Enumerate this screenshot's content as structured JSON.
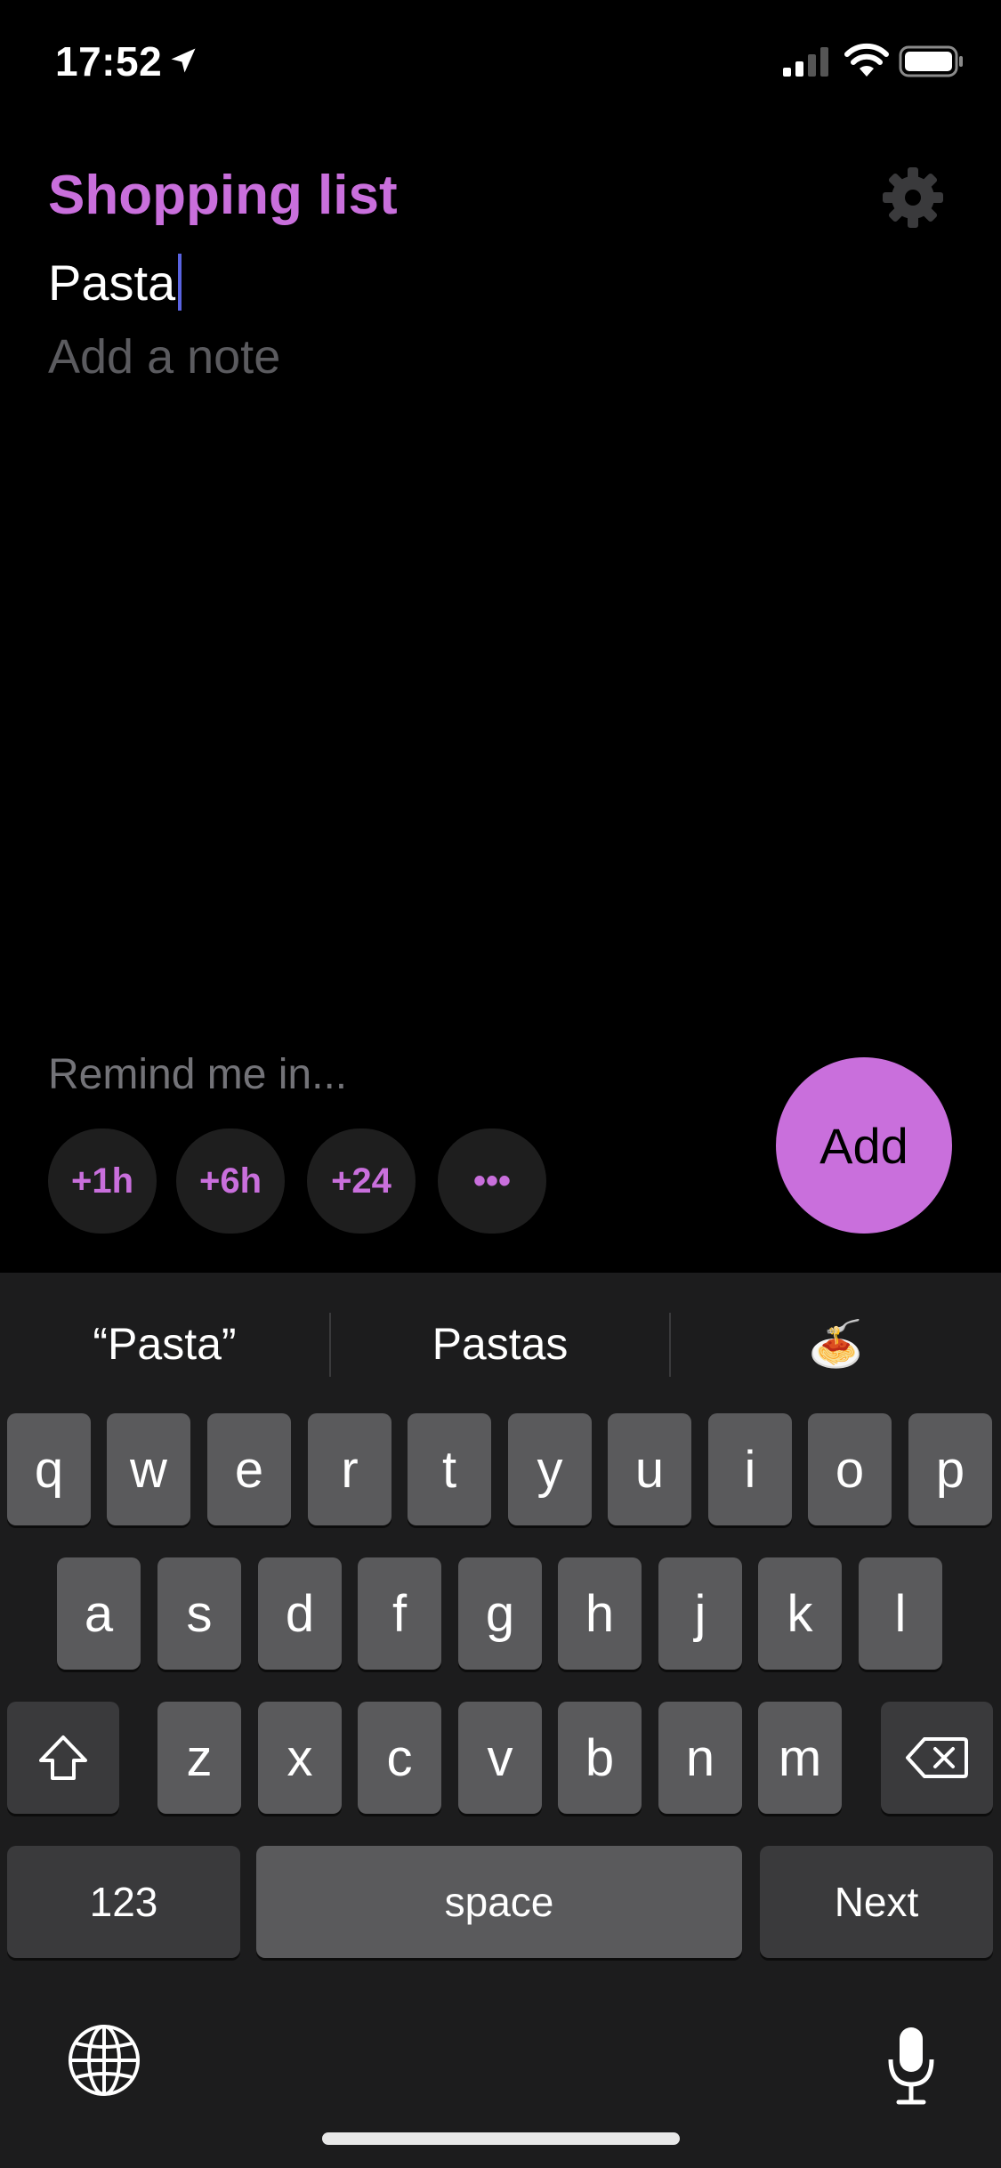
{
  "status_bar": {
    "time": "17:52",
    "icons": [
      "location-arrow-icon",
      "cellular-signal-icon",
      "wifi-icon",
      "battery-icon"
    ]
  },
  "header": {
    "title": "Shopping list",
    "settings_icon": "gear-icon"
  },
  "item_field": {
    "value": "Pasta"
  },
  "note_field": {
    "placeholder": "Add a note"
  },
  "reminder": {
    "label": "Remind me in...",
    "options": [
      "+1h",
      "+6h",
      "+24",
      "•••"
    ]
  },
  "add_button": {
    "label": "Add"
  },
  "keyboard": {
    "suggestions": [
      "“Pasta”",
      "Pastas",
      "🍝"
    ],
    "row1": [
      "q",
      "w",
      "e",
      "r",
      "t",
      "y",
      "u",
      "i",
      "o",
      "p"
    ],
    "row2": [
      "a",
      "s",
      "d",
      "f",
      "g",
      "h",
      "j",
      "k",
      "l"
    ],
    "row3": [
      "z",
      "x",
      "c",
      "v",
      "b",
      "n",
      "m"
    ],
    "numbers_key": "123",
    "space_key": "space",
    "return_key": "Next",
    "icons": [
      "shift-icon",
      "delete-icon",
      "globe-icon",
      "microphone-icon"
    ]
  },
  "colors": {
    "accent": "#c96fdc",
    "background": "#000000",
    "keyboard_bg": "#1c1c1d",
    "key": "#5a5a5c",
    "key_dark": "#3a3a3c",
    "caret": "#5a63e0"
  }
}
